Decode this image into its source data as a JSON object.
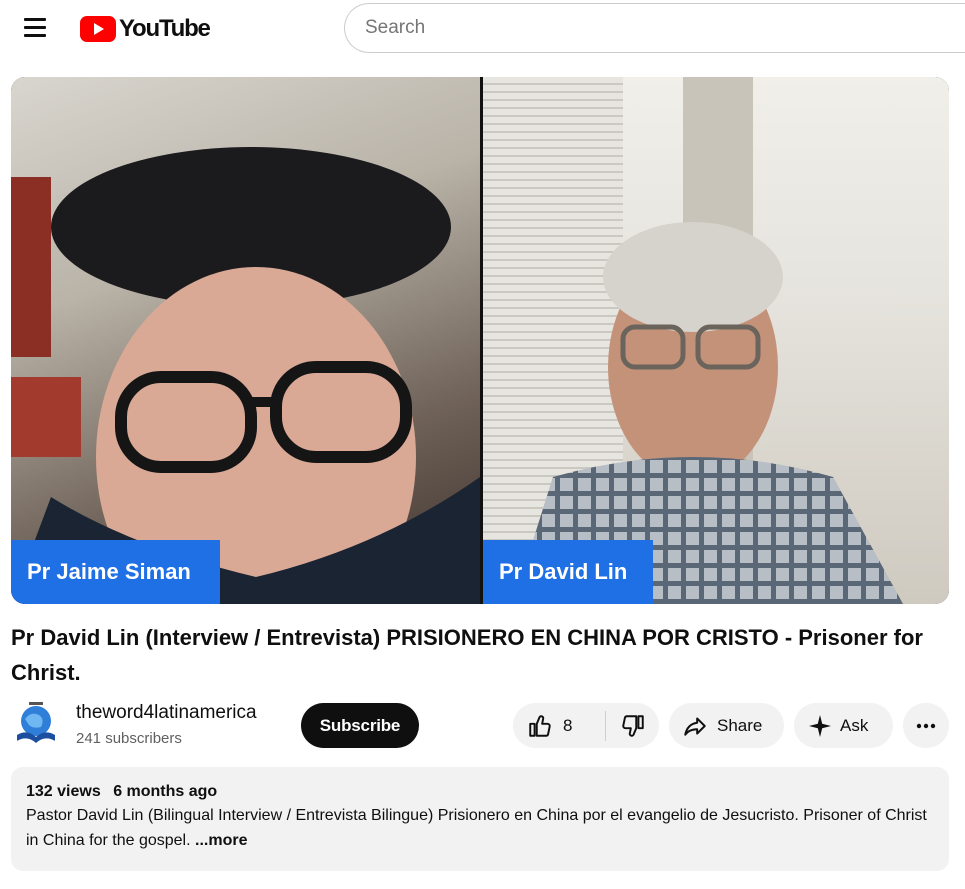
{
  "header": {
    "logo_text": "YouTube",
    "search_placeholder": "Search",
    "brand_color": "#ff0000"
  },
  "video": {
    "speaker_left": "Pr Jaime Siman",
    "speaker_right": "Pr David Lin",
    "tag_color": "#1f6fe5"
  },
  "title": "Pr David Lin (Interview / Entrevista) PRISIONERO EN CHINA POR CRISTO - Prisoner for Christ.",
  "channel": {
    "name": "theword4latinamerica",
    "subscribers": "241 subscribers",
    "subscribe_label": "Subscribe"
  },
  "actions": {
    "like_count": "8",
    "share_label": "Share",
    "ask_label": "Ask",
    "icons": [
      "thumbs-up-icon",
      "thumbs-down-icon",
      "share-arrow-icon",
      "sparkle-icon",
      "more-horizontal-icon"
    ]
  },
  "description": {
    "views": "132 views",
    "date": "6 months ago",
    "text": "Pastor David Lin (Bilingual Interview / Entrevista Bilingue) Prisionero en China por el evangelio de Jesucristo. Prisoner of Christ in China for the gospel. ",
    "more_label": "...more"
  }
}
